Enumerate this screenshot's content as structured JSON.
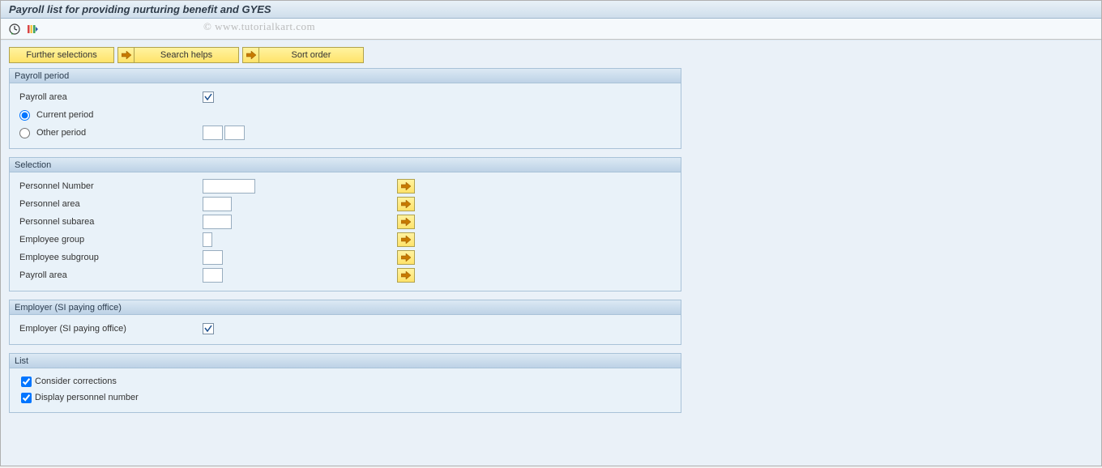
{
  "title": "Payroll list for providing nurturing benefit and GYES",
  "watermark": "© www.tutorialkart.com",
  "toolbar": {
    "buttons": [
      "Further selections",
      "Search helps",
      "Sort order"
    ]
  },
  "groups": {
    "payroll_period": {
      "legend": "Payroll period",
      "payroll_area_label": "Payroll area",
      "current_period_label": "Current period",
      "other_period_label": "Other period",
      "selected_radio": "current"
    },
    "selection": {
      "legend": "Selection",
      "fields": [
        {
          "label": "Personnel Number",
          "width": "w65"
        },
        {
          "label": "Personnel area",
          "width": "w40"
        },
        {
          "label": "Personnel subarea",
          "width": "w40"
        },
        {
          "label": "Employee group",
          "width": "w15"
        },
        {
          "label": "Employee subgroup",
          "width": "w30"
        },
        {
          "label": "Payroll area",
          "width": "w30"
        }
      ]
    },
    "employer": {
      "legend": "Employer (SI paying office)",
      "label": "Employer (SI paying office)"
    },
    "list": {
      "legend": "List",
      "consider_corrections_label": "Consider corrections",
      "display_pernr_label": "Display personnel number",
      "consider_corrections_checked": true,
      "display_pernr_checked": true
    }
  }
}
